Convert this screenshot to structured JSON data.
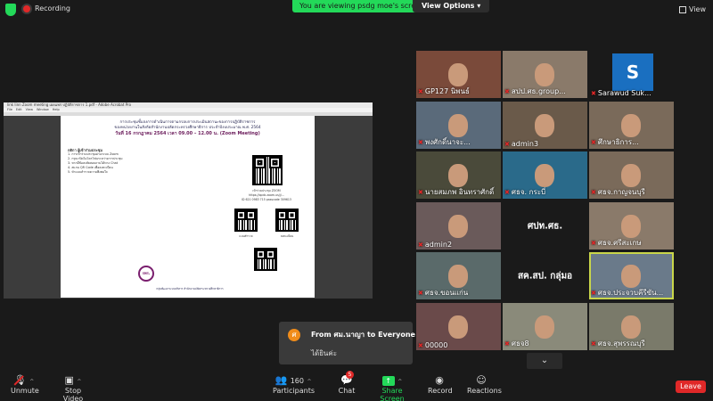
{
  "top": {
    "recording_label": "Recording",
    "viewing_banner": "You are viewing psdg moe's screen",
    "view_options": "View Options ▾",
    "view_button": "View"
  },
  "shared_screen": {
    "window_title": "link linn Zoom meeting เผยแพร่ ปฏิบัติราชการ 1.pdf - Adobe Acrobat Pro",
    "menu": [
      "File",
      "Edit",
      "View",
      "Window",
      "Help"
    ],
    "doc_title_1": "การประชุมชี้แจงการดำเนินการตามกรอบการประเมินสถานะของการปฏิบัติราชการ",
    "doc_title_2": "ของหน่วยงานในสังกัดสำนักงานปลัดกระทรวงศึกษาธิการ ประจำปีงบประมาณ พ.ศ. 2564",
    "doc_title_3": "วันที่ 16 กรกฎาคม 2564 เวลา 09.00 – 12.00 น. (Zoom Meeting)",
    "rules_title": "กติกา ผู้เข้าร่วมประชุม",
    "rules": [
      "1. การเข้าร่วมประชุมผ่านระบบ Zoom",
      "2. กรุณาปิดไมโครโฟนระหว่างการประชุม",
      "3. หากมีข้อสงสัยสอบถามได้ทาง Chat",
      "4. สแกน QR Code เพื่อลงทะเบียน",
      "5. ทำแบบสำรวจความพึงพอใจ"
    ],
    "zoom_label": "เข้าร่วมประชุม ZOOM",
    "zoom_link": "https://opdc.zoom.us/j/...",
    "meeting_id": "ID 621 0983 715  passcode 309613",
    "qr_caption_1": "แบบสำรวจ",
    "qr_caption_2": "ลงทะเบียน",
    "logo_text": "กพร.",
    "footer": "กลุ่มพัฒนาระบบบริหาร สำนักงานปลัดกระทรวงศึกษาธิการ"
  },
  "participants": [
    {
      "name": "GP127 นิพนธ์",
      "muted": true,
      "bg": "#7a4a3a"
    },
    {
      "name": "สปป.ศธ.group...",
      "muted": true,
      "bg": "#8a7a6a"
    },
    {
      "name": "Sarawud Suk...",
      "muted": true,
      "bg": "#1a1a1a",
      "avatar": "S"
    },
    {
      "name": "พงศักดิ์นาจะ...",
      "muted": true,
      "bg": "#5a6a7a"
    },
    {
      "name": "admin3",
      "muted": true,
      "bg": "#6a5a4a"
    },
    {
      "name": "ศึกษาธิการ...",
      "muted": true,
      "bg": "#7a6a5a"
    },
    {
      "name": "นายสมภพ อินทราศักดิ์",
      "muted": true,
      "bg": "#4a4a3a"
    },
    {
      "name": "ศธจ. กระบี่",
      "muted": true,
      "bg": "#2a6a8a"
    },
    {
      "name": "ศธจ.กาญจนบุรี",
      "muted": true,
      "bg": "#7a6a5a"
    },
    {
      "name": "admin2",
      "muted": true,
      "bg": "#6a5a5a"
    },
    {
      "name": "ศปท.ศธ.",
      "muted": false,
      "bg": "#1a1a1a",
      "center": true
    },
    {
      "name": "ศธจ.ศรีสะเกษ",
      "muted": true,
      "bg": "#8a7a6a"
    },
    {
      "name": "ศธจ.ขอนแก่น",
      "muted": true,
      "bg": "#5a6a6a"
    },
    {
      "name": "สค.สป. กลุ่มอ",
      "muted": false,
      "bg": "#1a1a1a",
      "center": true
    },
    {
      "name": "ศธจ.ประจวบคีรีขัน...",
      "muted": true,
      "bg": "#6a7a8a",
      "active": true
    },
    {
      "name": "00000",
      "muted": true,
      "bg": "#6a4a4a"
    },
    {
      "name": "ศธจ8",
      "muted": true,
      "bg": "#8a8a7a"
    },
    {
      "name": "ศธจ.สุพรรณบุรี",
      "muted": true,
      "bg": "#7a7a6a"
    }
  ],
  "chat": {
    "from": "From ศม.นาญา to Everyone",
    "message": "ได้ยินค่ะ",
    "icon_letter": "ศ"
  },
  "toolbar": {
    "unmute": "Unmute",
    "stop_video": "Stop Video",
    "participants": "Participants",
    "participants_count": "160",
    "chat": "Chat",
    "chat_badge": "5",
    "share_screen": "Share Screen",
    "record": "Record",
    "reactions": "Reactions",
    "leave": "Leave"
  },
  "colors": {
    "accent_green": "#23d959",
    "leave_red": "#e02828",
    "active_border": "#c9d64a"
  }
}
